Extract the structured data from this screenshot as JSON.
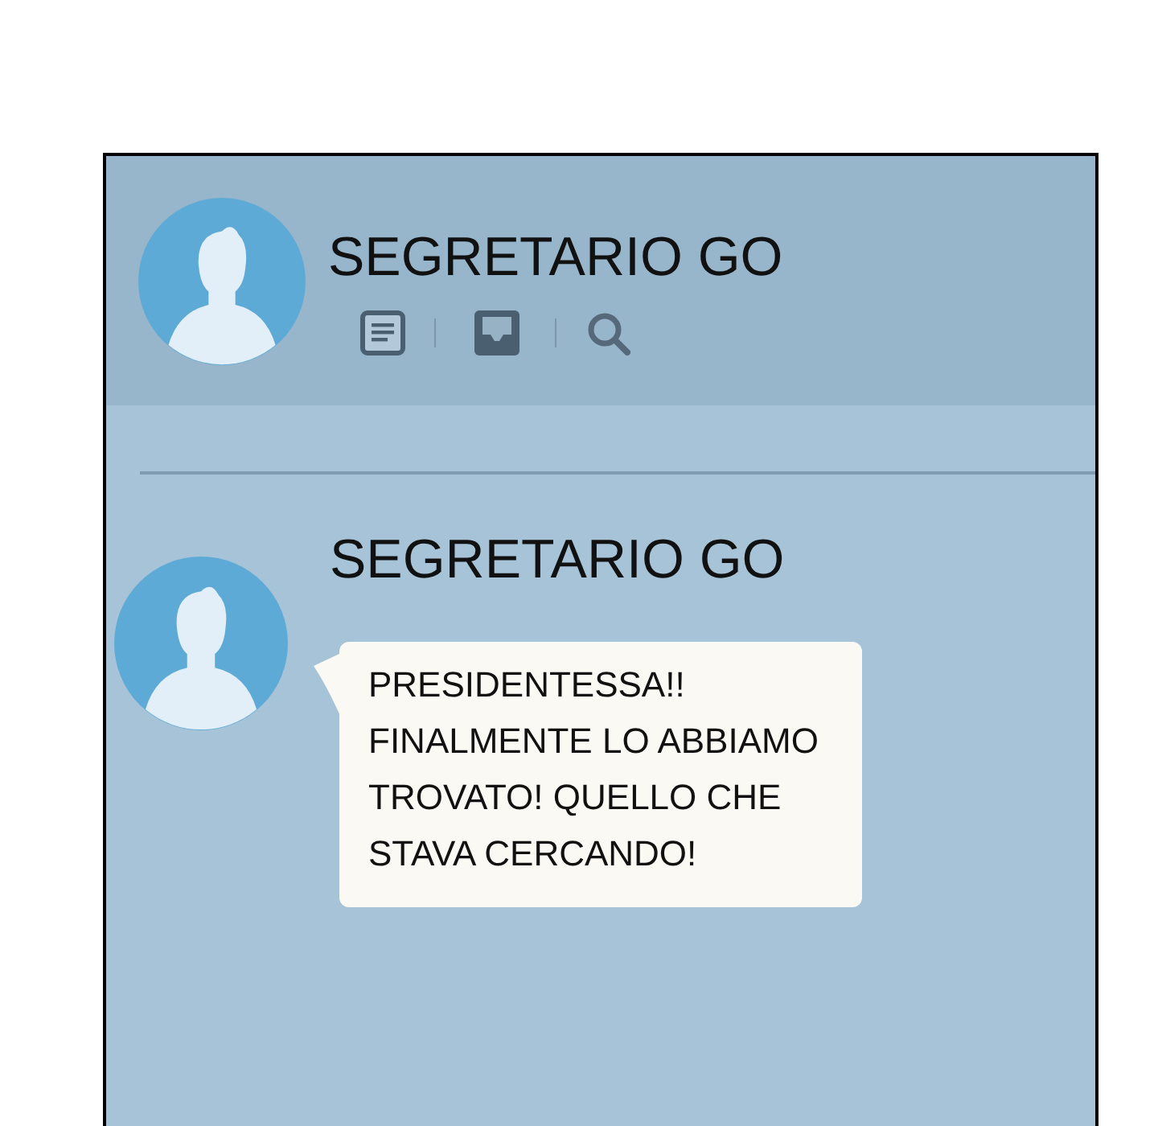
{
  "header": {
    "name": "SEGRETARIO GO"
  },
  "messages": [
    {
      "sender": "SEGRETARIO GO",
      "text": "PRESIDENTESSA!! FINALMENTE LO ABBIAMO TROVATO! QUELLO CHE STAVA CERCANDO!"
    }
  ]
}
